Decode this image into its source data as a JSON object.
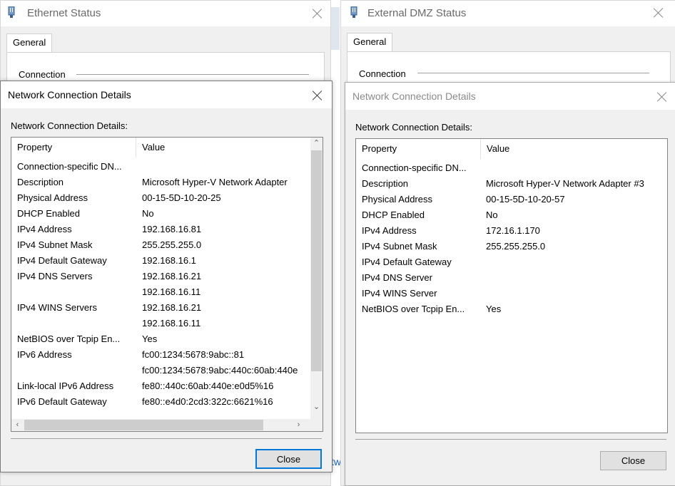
{
  "ethernet_status": {
    "title": "Ethernet Status",
    "tab_general": "General",
    "connection_label": "Connection"
  },
  "dmz_status": {
    "title": "External DMZ Status",
    "tab_general": "General",
    "connection_label": "Connection"
  },
  "background_fragment": "tw",
  "details_left": {
    "title": "Network Connection Details",
    "label": "Network Connection Details:",
    "col_property": "Property",
    "col_value": "Value",
    "rows": [
      {
        "property": "Connection-specific DN...",
        "value": ""
      },
      {
        "property": "Description",
        "value": "Microsoft Hyper-V Network Adapter"
      },
      {
        "property": "Physical Address",
        "value": "00-15-5D-10-20-25"
      },
      {
        "property": "DHCP Enabled",
        "value": "No"
      },
      {
        "property": "IPv4 Address",
        "value": "192.168.16.81"
      },
      {
        "property": "IPv4 Subnet Mask",
        "value": "255.255.255.0"
      },
      {
        "property": "IPv4 Default Gateway",
        "value": "192.168.16.1"
      },
      {
        "property": "IPv4 DNS Servers",
        "value": "192.168.16.21"
      },
      {
        "property": "",
        "value": "192.168.16.11"
      },
      {
        "property": "IPv4 WINS Servers",
        "value": "192.168.16.21"
      },
      {
        "property": "",
        "value": "192.168.16.11"
      },
      {
        "property": "NetBIOS over Tcpip En...",
        "value": "Yes"
      },
      {
        "property": "IPv6 Address",
        "value": "fc00:1234:5678:9abc::81"
      },
      {
        "property": "",
        "value": "fc00:1234:5678:9abc:440c:60ab:440e"
      },
      {
        "property": "Link-local IPv6 Address",
        "value": "fe80::440c:60ab:440e:e0d5%16"
      },
      {
        "property": "IPv6 Default Gateway",
        "value": "fe80::e4d0:2cd3:322c:6621%16"
      }
    ],
    "close_label": "Close"
  },
  "details_right": {
    "title": "Network Connection Details",
    "label": "Network Connection Details:",
    "col_property": "Property",
    "col_value": "Value",
    "rows": [
      {
        "property": "Connection-specific DN...",
        "value": ""
      },
      {
        "property": "Description",
        "value": "Microsoft Hyper-V Network Adapter #3"
      },
      {
        "property": "Physical Address",
        "value": "00-15-5D-10-20-57"
      },
      {
        "property": "DHCP Enabled",
        "value": "No"
      },
      {
        "property": "IPv4 Address",
        "value": "172.16.1.170"
      },
      {
        "property": "IPv4 Subnet Mask",
        "value": "255.255.255.0"
      },
      {
        "property": "IPv4 Default Gateway",
        "value": ""
      },
      {
        "property": "IPv4 DNS Server",
        "value": ""
      },
      {
        "property": "IPv4 WINS Server",
        "value": ""
      },
      {
        "property": "NetBIOS over Tcpip En...",
        "value": "Yes"
      }
    ],
    "close_label": "Close"
  },
  "icons": {
    "network_adapter": "network-adapter-icon",
    "close": "close-icon",
    "scroll_up": "scroll-up-arrow-icon",
    "scroll_down": "scroll-down-arrow-icon",
    "scroll_left": "scroll-left-arrow-icon",
    "scroll_right": "scroll-right-arrow-icon"
  },
  "colors": {
    "focus_border": "#0078d7",
    "dialog_background": "#f0f0f0",
    "list_background": "#ffffff"
  }
}
